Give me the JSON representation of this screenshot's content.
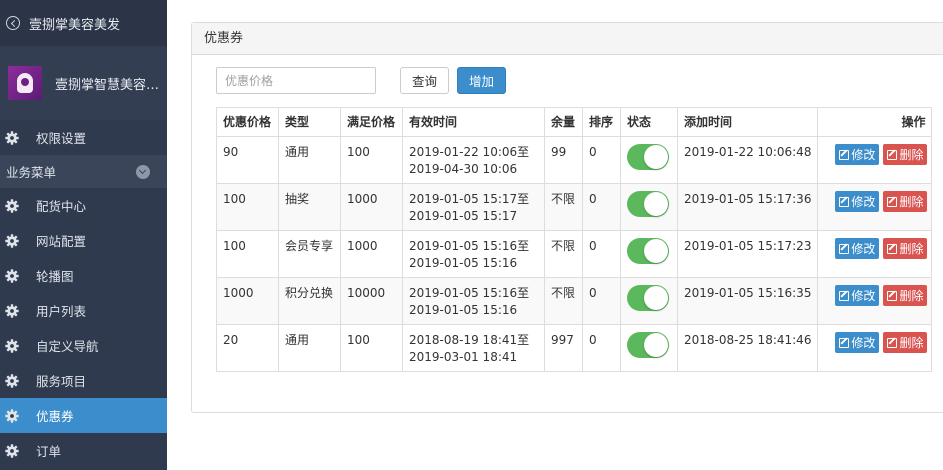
{
  "app": {
    "title": "壹捌掌美容美发",
    "profile_name": "壹捌掌智慧美容…"
  },
  "sidebar": {
    "top_item": {
      "label": "权限设置",
      "icon": "gear-icon"
    },
    "section_label": "业务菜单",
    "items": [
      {
        "label": "配货中心",
        "icon": "gear-icon",
        "active": false
      },
      {
        "label": "网站配置",
        "icon": "gear-icon",
        "active": false
      },
      {
        "label": "轮播图",
        "icon": "gear-icon",
        "active": false
      },
      {
        "label": "用户列表",
        "icon": "gear-icon",
        "active": false
      },
      {
        "label": "自定义导航",
        "icon": "gear-icon",
        "active": false
      },
      {
        "label": "服务项目",
        "icon": "gear-icon",
        "active": false
      },
      {
        "label": "优惠券",
        "icon": "gear-icon",
        "active": true
      },
      {
        "label": "订单",
        "icon": "gear-icon",
        "active": false
      }
    ]
  },
  "panel": {
    "title": "优惠券",
    "search": {
      "placeholder": "优惠价格",
      "value": ""
    },
    "query_label": "查询",
    "add_label": "增加"
  },
  "table": {
    "columns": [
      "优惠价格",
      "类型",
      "满足价格",
      "有效时间",
      "余量",
      "排序",
      "状态",
      "添加时间",
      "操作"
    ],
    "edit_label": "修改",
    "delete_label": "删除",
    "rows": [
      {
        "price": "90",
        "type": "通用",
        "min": "100",
        "valid_from": "2019-01-22 10:06至",
        "valid_to": "2019-04-30 10:06",
        "remain": "99",
        "sort": "0",
        "status_on": true,
        "added": "2019-01-22 10:06:48"
      },
      {
        "price": "100",
        "type": "抽奖",
        "min": "1000",
        "valid_from": "2019-01-05 15:17至",
        "valid_to": "2019-01-05 15:17",
        "remain": "不限",
        "sort": "0",
        "status_on": true,
        "added": "2019-01-05 15:17:36"
      },
      {
        "price": "100",
        "type": "会员专享",
        "min": "1000",
        "valid_from": "2019-01-05 15:16至",
        "valid_to": "2019-01-05 15:16",
        "remain": "不限",
        "sort": "0",
        "status_on": true,
        "added": "2019-01-05 15:17:23"
      },
      {
        "price": "1000",
        "type": "积分兑换",
        "min": "10000",
        "valid_from": "2019-01-05 15:16至",
        "valid_to": "2019-01-05 15:16",
        "remain": "不限",
        "sort": "0",
        "status_on": true,
        "added": "2019-01-05 15:16:35"
      },
      {
        "price": "20",
        "type": "通用",
        "min": "100",
        "valid_from": "2018-08-19 18:41至",
        "valid_to": "2019-03-01 18:41",
        "remain": "997",
        "sort": "0",
        "status_on": true,
        "added": "2018-08-25 18:41:46"
      }
    ]
  },
  "colors": {
    "sidebar_bg": "#2f3a4e",
    "accent": "#3c8dcc",
    "switch_on": "#5cb85c",
    "danger": "#d9534f"
  }
}
